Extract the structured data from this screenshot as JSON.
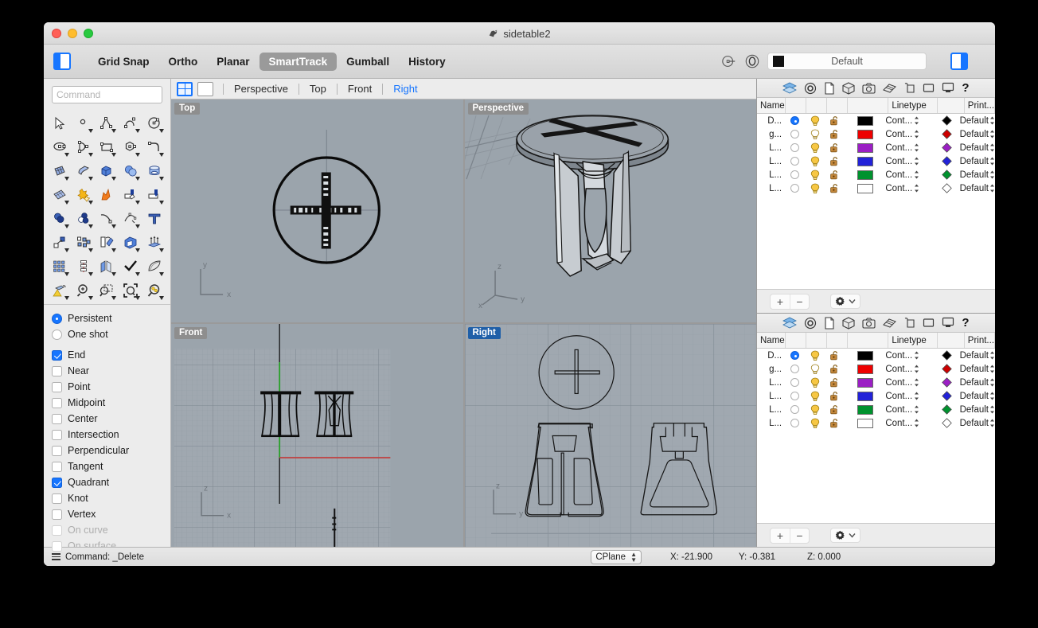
{
  "window": {
    "title": "sidetable2",
    "traffic_lights": [
      "close",
      "minimize",
      "maximize"
    ]
  },
  "toolbar": {
    "left_panel_toggle": "left-panel-toggle",
    "right_panel_toggle": "right-panel-toggle",
    "items": [
      {
        "label": "Grid Snap",
        "active": false
      },
      {
        "label": "Ortho",
        "active": false
      },
      {
        "label": "Planar",
        "active": false
      },
      {
        "label": "SmartTrack",
        "active": true
      },
      {
        "label": "Gumball",
        "active": false
      },
      {
        "label": "History",
        "active": false
      }
    ],
    "layer_selector": {
      "value": "Default",
      "swatch_color": "#111111"
    }
  },
  "command_bar": {
    "placeholder": "Command",
    "value": ""
  },
  "osnap": {
    "mode_options": [
      {
        "label": "Persistent",
        "selected": true
      },
      {
        "label": "One shot",
        "selected": false
      }
    ],
    "snaps": [
      {
        "label": "End",
        "checked": true,
        "enabled": true
      },
      {
        "label": "Near",
        "checked": false,
        "enabled": true
      },
      {
        "label": "Point",
        "checked": false,
        "enabled": true
      },
      {
        "label": "Midpoint",
        "checked": false,
        "enabled": true
      },
      {
        "label": "Center",
        "checked": false,
        "enabled": true
      },
      {
        "label": "Intersection",
        "checked": false,
        "enabled": true
      },
      {
        "label": "Perpendicular",
        "checked": false,
        "enabled": true
      },
      {
        "label": "Tangent",
        "checked": false,
        "enabled": true
      },
      {
        "label": "Quadrant",
        "checked": true,
        "enabled": true
      },
      {
        "label": "Knot",
        "checked": false,
        "enabled": true
      },
      {
        "label": "Vertex",
        "checked": false,
        "enabled": true
      },
      {
        "label": "On curve",
        "checked": false,
        "enabled": false
      },
      {
        "label": "On surface",
        "checked": false,
        "enabled": false
      }
    ]
  },
  "viewport_bar": {
    "layout_quad": "quad-viewport-layout",
    "layout_single": "single-viewport-layout",
    "tabs": [
      {
        "label": "Perspective",
        "selected": false
      },
      {
        "label": "Top",
        "selected": false
      },
      {
        "label": "Front",
        "selected": false
      },
      {
        "label": "Right",
        "selected": true
      }
    ]
  },
  "viewports": [
    {
      "name": "Top",
      "active": false,
      "axes": [
        "y",
        "x"
      ],
      "grid": false
    },
    {
      "name": "Perspective",
      "active": false,
      "axes": [
        "z",
        "y",
        "x"
      ],
      "grid": true
    },
    {
      "name": "Front",
      "active": false,
      "axes": [
        "z",
        "x"
      ],
      "grid": true
    },
    {
      "name": "Right",
      "active": true,
      "axes": [
        "z",
        "y"
      ],
      "grid": true
    }
  ],
  "layers_panel": {
    "toolbar_icons": [
      "layers-icon",
      "properties-icon",
      "document-icon",
      "object-icon",
      "camera-icon",
      "material-icon",
      "display-icon",
      "view-icon",
      "monitor-icon",
      "help-icon"
    ],
    "columns": [
      "Name",
      "",
      "",
      "",
      "",
      "",
      "Linetype",
      "",
      "Print..."
    ],
    "rows": [
      {
        "name": "D...",
        "current": true,
        "on": true,
        "locked": false,
        "color": "#000000",
        "linetype": "Cont...",
        "print_color": "#000000",
        "print_width": "Default"
      },
      {
        "name": "g...",
        "current": false,
        "on": false,
        "locked": false,
        "color": "#ee0000",
        "linetype": "Cont...",
        "print_color": "#cc0000",
        "print_width": "Default"
      },
      {
        "name": "L...",
        "current": false,
        "on": true,
        "locked": false,
        "color": "#9b1fc4",
        "linetype": "Cont...",
        "print_color": "#9b1fc4",
        "print_width": "Default"
      },
      {
        "name": "L...",
        "current": false,
        "on": true,
        "locked": false,
        "color": "#2222d8",
        "linetype": "Cont...",
        "print_color": "#2222d8",
        "print_width": "Default"
      },
      {
        "name": "L...",
        "current": false,
        "on": true,
        "locked": false,
        "color": "#00922e",
        "linetype": "Cont...",
        "print_color": "#00922e",
        "print_width": "Default"
      },
      {
        "name": "L...",
        "current": false,
        "on": true,
        "locked": false,
        "color": "#ffffff",
        "linetype": "Cont...",
        "print_color": "#ffffff",
        "print_width": "Default"
      }
    ],
    "footer": {
      "add_label": "+",
      "remove_label": "−",
      "gear_label": "gear"
    }
  },
  "statusbar": {
    "command_label": "Command: _Delete",
    "cplane_label": "CPlane",
    "x": "X: -21.900",
    "y": "Y: -0.381",
    "z": "Z: 0.000"
  },
  "colors": {
    "accent": "#1675ff",
    "viewport_bg": "#9ba4ac",
    "active_tab_bg": "#1f5fa8",
    "chrome": "#ececec"
  }
}
